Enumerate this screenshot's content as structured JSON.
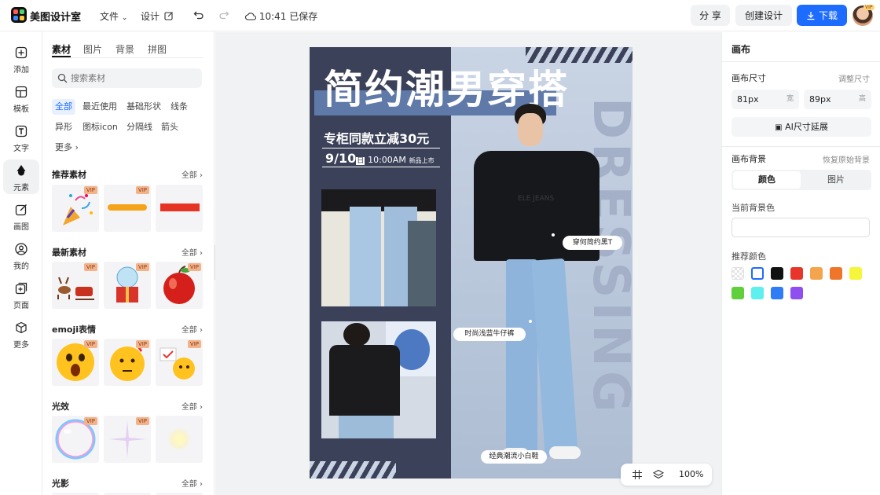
{
  "app": {
    "name": "美图设计室"
  },
  "topbar": {
    "file_menu": "文件",
    "design_menu": "设计",
    "save_status": "10:41 已保存",
    "share_label": "分 享",
    "create_label": "创建设计",
    "download_label": "下载",
    "avatar_badge": "VIP"
  },
  "leftnav": {
    "items": [
      {
        "label": "添加",
        "icon": "plus-square-icon"
      },
      {
        "label": "模板",
        "icon": "template-icon"
      },
      {
        "label": "文字",
        "icon": "text-icon"
      },
      {
        "label": "元素",
        "icon": "shapes-icon"
      },
      {
        "label": "画图",
        "icon": "edit-icon"
      },
      {
        "label": "我的",
        "icon": "user-icon"
      },
      {
        "label": "页面",
        "icon": "add-page-icon"
      },
      {
        "label": "更多",
        "icon": "cube-icon"
      }
    ],
    "active_index": 3
  },
  "panel": {
    "tabs": [
      "素材",
      "图片",
      "背景",
      "拼图"
    ],
    "search_placeholder": "搜索素材",
    "chips": [
      "全部",
      "最近使用",
      "基础形状",
      "线条",
      "异形",
      "图标icon",
      "分隔线",
      "箭头",
      "更多"
    ],
    "vip": "VIP",
    "sections": [
      {
        "title": "推荐素材",
        "all": "全部"
      },
      {
        "title": "最新素材",
        "all": "全部"
      },
      {
        "title": "emoji表情",
        "all": "全部"
      },
      {
        "title": "光效",
        "all": "全部"
      },
      {
        "title": "光影",
        "all": "全部"
      }
    ]
  },
  "poster": {
    "title": "简约潮男穿搭",
    "subtitle": "专柜同款立减30元",
    "date_big": "9/10",
    "date_day": "日",
    "date_rest": "10:00AM",
    "date_tag": "新品上市",
    "vertical_text": "DRESSING",
    "callout_1": "穿何简约黑T",
    "callout_2": "时尚浅蓝牛仔裤",
    "callout_3": "经典潮流小白鞋",
    "shirt_print": "ELE JEANS"
  },
  "right": {
    "title": "画布",
    "size_label": "画布尺寸",
    "size_action": "调整尺寸",
    "width_value": "81px",
    "width_unit": "宽",
    "height_value": "89px",
    "height_unit": "高",
    "ai_button": "AI尺寸延展",
    "bg_label": "画布背景",
    "bg_reset": "恢复原始背景",
    "bg_tab_color": "颜色",
    "bg_tab_image": "图片",
    "current_bg_label": "当前背景色",
    "recommend_label": "推荐颜色",
    "swatches": [
      "transparent",
      "#ffffff",
      "#111111",
      "#e8352c",
      "#f3a44c",
      "#ef7528",
      "#f5f53a",
      "#5fcf3c",
      "#5ef0ee",
      "#2f7cf6",
      "#8f4ff0"
    ]
  },
  "zoom": {
    "value": "100%"
  }
}
